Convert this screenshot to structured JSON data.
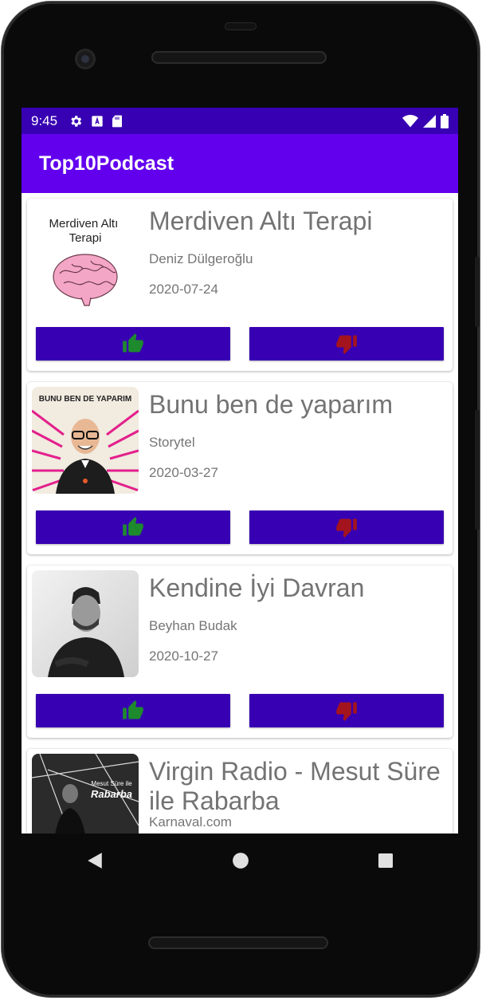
{
  "status_bar": {
    "time": "9:45"
  },
  "app_bar": {
    "title": "Top10Podcast"
  },
  "podcasts": [
    {
      "title": "Merdiven Altı Terapi",
      "author": "Deniz Dülgeroğlu",
      "date": "2020-07-24",
      "cover_text": "Merdiven Altı Terapi"
    },
    {
      "title": "Bunu ben de yaparım",
      "author": "Storytel",
      "date": "2020-03-27",
      "cover_text": "BUNU BEN DE YAPARIM"
    },
    {
      "title": "Kendine İyi Davran",
      "author": "Beyhan Budak",
      "date": "2020-10-27"
    },
    {
      "title": "Virgin Radio - Mesut Süre ile Rabarba",
      "author": "Karnaval.com",
      "date": "",
      "cover_text": "Mesut Süre ile Rabarba"
    }
  ],
  "icons": {
    "like": "thumb-up-icon",
    "dislike": "thumb-down-icon"
  },
  "colors": {
    "status_bar": "#3700b3",
    "app_bar": "#6200ee",
    "button": "#3700b3",
    "like_icon": "#1e8a2e",
    "dislike_icon": "#a3141e"
  }
}
